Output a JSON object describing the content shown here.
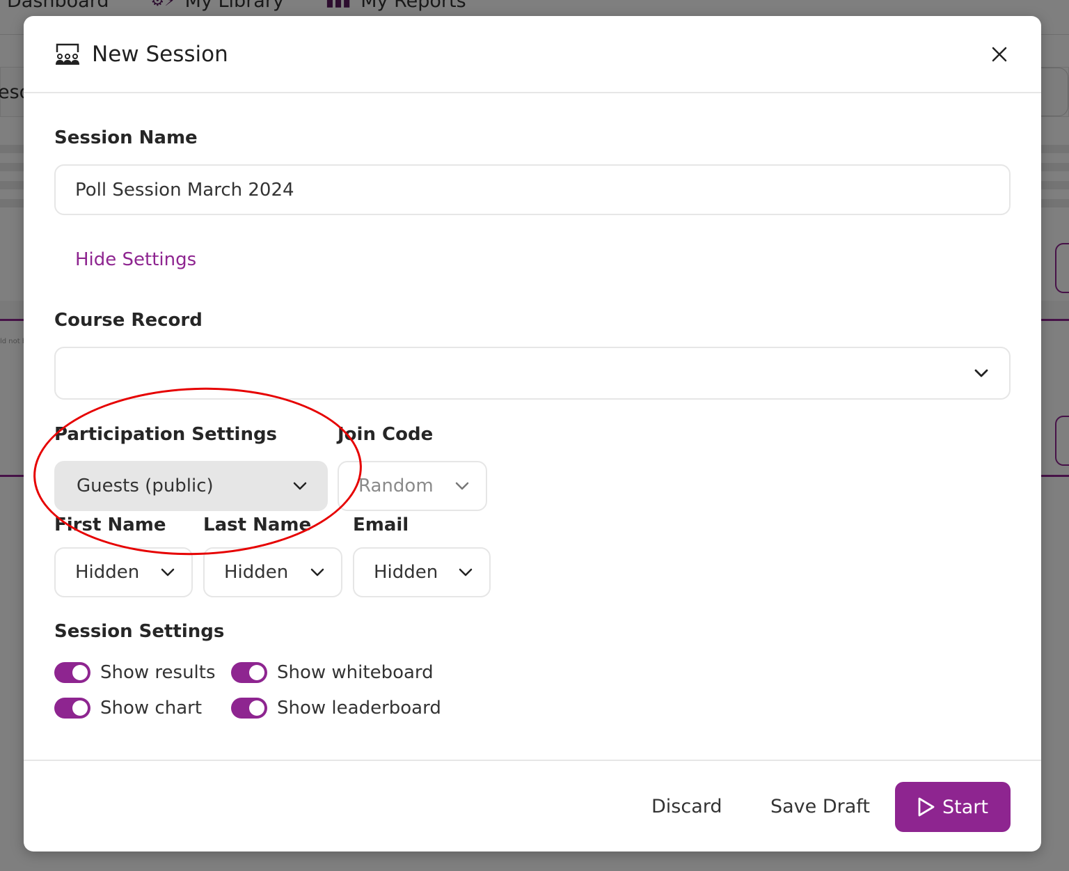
{
  "background": {
    "nav": [
      {
        "label": "Dashboard",
        "icon": "dashboard-icon"
      },
      {
        "label": "My Library",
        "icon": "library-icon"
      },
      {
        "label": "My Reports",
        "icon": "reports-icon"
      }
    ],
    "row_fragment": "eso",
    "error_fragment": "ld not b"
  },
  "modal": {
    "title": "New Session",
    "title_icon": "presentation-audience-icon",
    "close_icon": "close-icon",
    "session_name": {
      "label": "Session Name",
      "value": "Poll Session March 2024"
    },
    "toggle_settings_link": "Hide Settings",
    "course_record": {
      "label": "Course Record",
      "value": ""
    },
    "participation": {
      "label": "Participation Settings",
      "value": "Guests (public)"
    },
    "join_code": {
      "label": "Join Code",
      "value": "Random"
    },
    "first_name": {
      "label": "First Name",
      "value": "Hidden"
    },
    "last_name": {
      "label": "Last Name",
      "value": "Hidden"
    },
    "email": {
      "label": "Email",
      "value": "Hidden"
    },
    "session_settings": {
      "label": "Session Settings",
      "toggles": [
        {
          "label": "Show results",
          "on": true
        },
        {
          "label": "Show whiteboard",
          "on": true
        },
        {
          "label": "Show chart",
          "on": true
        },
        {
          "label": "Show leaderboard",
          "on": true
        }
      ]
    },
    "footer": {
      "discard": "Discard",
      "save_draft": "Save Draft",
      "start": "Start"
    }
  },
  "colors": {
    "accent": "#8e2590",
    "annotation": "#e60000",
    "overlay": "#7f7f7f"
  }
}
